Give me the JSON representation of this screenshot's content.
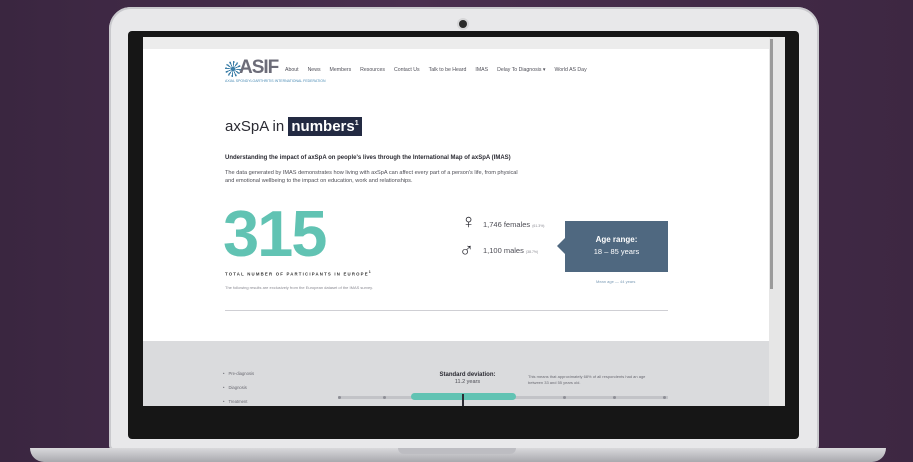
{
  "header": {
    "logo_text": "ASIF",
    "logo_subtext": "AXIAL SPONDYLOARTHRITIS INTERNATIONAL FEDERATION",
    "nav": [
      "About",
      "News",
      "Members",
      "Resources",
      "Contact Us",
      "Talk to be Heard",
      "IMAS",
      "Delay To Diagnosis ▾",
      "World AS Day"
    ]
  },
  "hero": {
    "title_prefix": "axSpA in",
    "title_highlight": "numbers",
    "title_sup": "1",
    "subtitle": "Understanding the impact of axSpA on people's lives through the International Map of axSpA (IMAS)",
    "intro": "The data generated by IMAS demonstrates how living with axSpA can affect every part of a person's life, from physical and emotional wellbeing to the impact on education, work and relationships."
  },
  "stats": {
    "total": "315",
    "total_label": "TOTAL NUMBER OF PARTICIPANTS IN EUROPE",
    "total_sup": "1",
    "note": "The following results are exclusively from the European dataset of the IMAS survey.",
    "females": "1,746 females",
    "females_pct": "(61.3%)",
    "males": "1,100 males",
    "males_pct": "(38.7%)",
    "age_title": "Age range:",
    "age_range": "18 – 85 years",
    "age_note": "Mean age — 44 years"
  },
  "lower": {
    "list": [
      "Pre-diagnosis",
      "Diagnosis",
      "Treatment"
    ],
    "sd_title": "Standard deviation:",
    "sd_value": "11.2 years",
    "sd_note": "This means that approximately 68% of all respondents had an age between 33 and 55 years old."
  },
  "colors": {
    "accent_teal": "#61c3b3",
    "navy": "#232a42",
    "box_blue": "#4f6880"
  }
}
